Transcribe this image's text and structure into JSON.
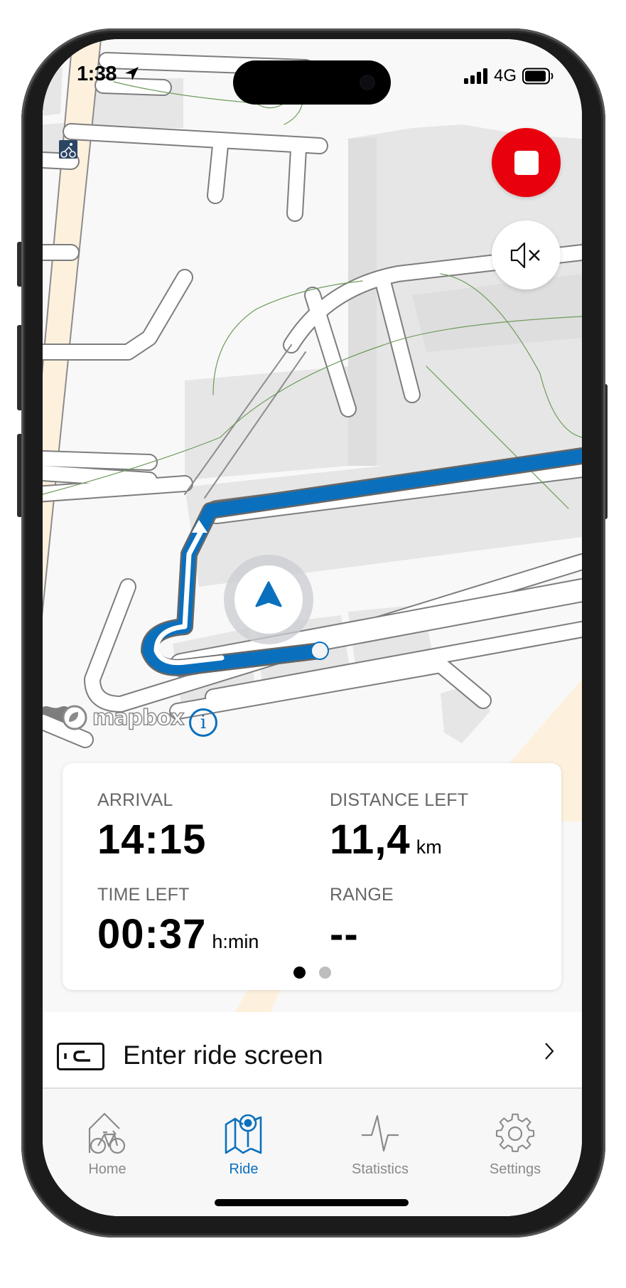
{
  "status_bar": {
    "time": "1:38",
    "location_icon": "location-arrow-icon",
    "network": "4G",
    "signal_icon": "signal-bars-icon",
    "battery_icon": "battery-icon"
  },
  "map": {
    "stop_button_icon": "stop-icon",
    "mute_button_icon": "speaker-muted-icon",
    "attribution_logo": "mapbox",
    "info_icon_glyph": "i",
    "route_color": "#0A70BD",
    "stop_color": "#E8000C"
  },
  "ride_info_card": {
    "arrival": {
      "label": "ARRIVAL",
      "value": "14:15",
      "unit": ""
    },
    "distance_left": {
      "label": "DISTANCE LEFT",
      "value": "11,4",
      "unit": "km"
    },
    "time_left": {
      "label": "TIME LEFT",
      "value": "00:37",
      "unit": "h:min"
    },
    "range": {
      "label": "RANGE",
      "value": "--",
      "unit": ""
    },
    "pager": {
      "pages": 2,
      "active": 1
    }
  },
  "ride_screen_row": {
    "label": "Enter ride screen",
    "icon": "display-unit-icon",
    "chevron": "chevron-right-icon"
  },
  "tabbar": {
    "accent": "#0A70BD",
    "items": [
      {
        "label": "Home",
        "icon": "home-bike-icon",
        "active": false
      },
      {
        "label": "Ride",
        "icon": "map-pin-icon",
        "active": true
      },
      {
        "label": "Statistics",
        "icon": "pulse-icon",
        "active": false
      },
      {
        "label": "Settings",
        "icon": "gear-icon",
        "active": false
      }
    ]
  }
}
